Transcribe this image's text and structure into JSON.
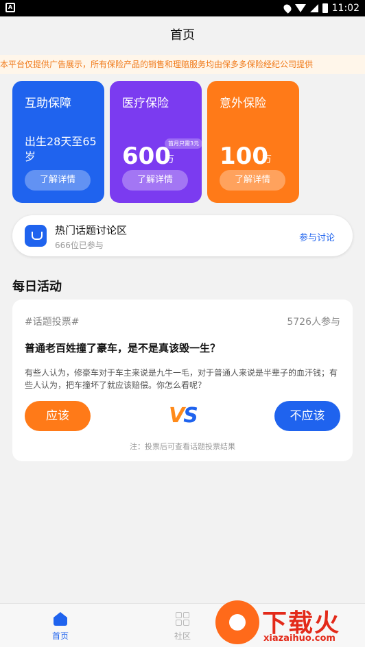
{
  "status_bar": {
    "time": "11:02",
    "notif_letter": "A"
  },
  "header": {
    "title": "首页"
  },
  "notice": {
    "text": "本平台仅提供广告展示，所有保险产品的销售和理赔服务均由保多多保险经纪公司提供"
  },
  "cards": [
    {
      "title": "互助保障",
      "desc": "出生28天至65岁",
      "button": "了解详情",
      "color": "#1f63ee"
    },
    {
      "title": "医疗保险",
      "amount": "600",
      "unit": "万",
      "badge": "首月只需3元",
      "button": "了解详情",
      "color": "#7b3bf0"
    },
    {
      "title": "意外保险",
      "amount": "100",
      "unit": "万",
      "button": "了解详情",
      "color": "#ff7a18"
    }
  ],
  "topic": {
    "title": "热门话题讨论区",
    "participants": "666位已参与",
    "join": "参与讨论"
  },
  "daily": {
    "title": "每日活动",
    "vote": {
      "tag": "#话题投票#",
      "count": "5726人参与",
      "question": "普通老百姓撞了豪车，是不是真该毁一生？",
      "description": "有些人认为，修豪车对于车主来说是九牛一毛，对于普通人来说是半辈子的血汗钱；有些人认为，把车撞坏了就应该赔偿。你怎么看呢？",
      "yes": "应该",
      "no": "不应该",
      "vs_v": "V",
      "vs_s": "S",
      "note": "注：投票后可查看话题投票结果"
    }
  },
  "tabbar": {
    "home": "首页",
    "community": "社区"
  },
  "watermark": {
    "text": "下载火",
    "url": "xiazaihuo.com"
  }
}
